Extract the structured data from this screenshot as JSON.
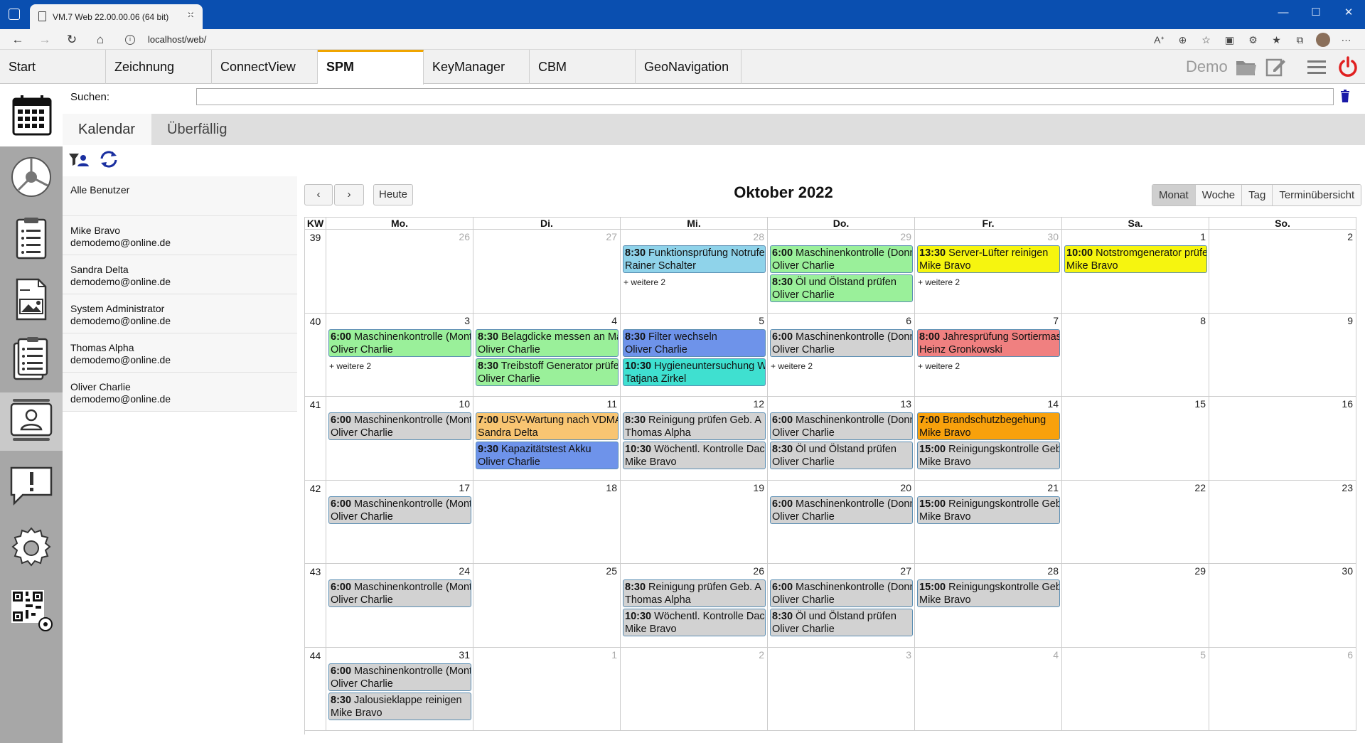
{
  "browser": {
    "tab_title": "VM.7 Web 22.00.00.06 (64 bit)",
    "url": "localhost/web/"
  },
  "app_menu": {
    "tabs": [
      "Start",
      "Zeichnung",
      "ConnectView",
      "SPM",
      "KeyManager",
      "CBM",
      "GeoNavigation"
    ],
    "active": "SPM",
    "demo_label": "Demo"
  },
  "search": {
    "label": "Suchen:",
    "value": ""
  },
  "content_tabs": [
    "Kalendar",
    "Überfällig"
  ],
  "users": {
    "all_label": "Alle Benutzer",
    "items": [
      {
        "name": "Mike Bravo",
        "email": "demodemo@online.de"
      },
      {
        "name": "Sandra Delta",
        "email": "demodemo@online.de"
      },
      {
        "name": "System Administrator",
        "email": "demodemo@online.de"
      },
      {
        "name": "Thomas Alpha",
        "email": "demodemo@online.de"
      },
      {
        "name": "Oliver Charlie",
        "email": "demodemo@online.de"
      }
    ]
  },
  "calendar": {
    "title": "Oktober 2022",
    "today_label": "Heute",
    "views": [
      "Monat",
      "Woche",
      "Tag",
      "Terminübersicht"
    ],
    "active_view": "Monat",
    "kw_header": "KW",
    "day_headers": [
      "Mo.",
      "Di.",
      "Mi.",
      "Do.",
      "Fr.",
      "Sa.",
      "So."
    ],
    "weeks": [
      {
        "kw": "39",
        "days": [
          "26",
          "27",
          "28",
          "29",
          "30",
          "1",
          "2"
        ],
        "other": [
          true,
          true,
          true,
          true,
          true,
          false,
          false
        ]
      },
      {
        "kw": "40",
        "days": [
          "3",
          "4",
          "5",
          "6",
          "7",
          "8",
          "9"
        ],
        "other": [
          false,
          false,
          false,
          false,
          false,
          false,
          false
        ]
      },
      {
        "kw": "41",
        "days": [
          "10",
          "11",
          "12",
          "13",
          "14",
          "15",
          "16"
        ],
        "other": [
          false,
          false,
          false,
          false,
          false,
          false,
          false
        ]
      },
      {
        "kw": "42",
        "days": [
          "17",
          "18",
          "19",
          "20",
          "21",
          "22",
          "23"
        ],
        "other": [
          false,
          false,
          false,
          false,
          false,
          false,
          false
        ]
      },
      {
        "kw": "43",
        "days": [
          "24",
          "25",
          "26",
          "27",
          "28",
          "29",
          "30"
        ],
        "other": [
          false,
          false,
          false,
          false,
          false,
          false,
          false
        ]
      },
      {
        "kw": "44",
        "days": [
          "31",
          "1",
          "2",
          "3",
          "4",
          "5",
          "6"
        ],
        "other": [
          false,
          true,
          true,
          true,
          true,
          true,
          true
        ]
      }
    ],
    "events": [
      {
        "week": 0,
        "day": 2,
        "slot": 0,
        "time": "8:30",
        "title": "Funktionsprüfung Notrufe",
        "person": "Rainer Schalter",
        "color": "#8fd3ea"
      },
      {
        "week": 0,
        "day": 3,
        "slot": 0,
        "time": "6:00",
        "title": "Maschinenkontrolle (Donnerstag)",
        "person": "Oliver Charlie",
        "color": "#9af09a"
      },
      {
        "week": 0,
        "day": 3,
        "slot": 1,
        "time": "8:30",
        "title": "Öl und Ölstand prüfen",
        "person": "Oliver Charlie",
        "color": "#9af09a"
      },
      {
        "week": 0,
        "day": 4,
        "slot": 0,
        "time": "13:30",
        "title": "Server-Lüfter reinigen",
        "person": "Mike Bravo",
        "color": "#f6f50f"
      },
      {
        "week": 0,
        "day": 5,
        "slot": 0,
        "time": "10:00",
        "title": "Notstromgenerator prüfen",
        "person": "Mike Bravo",
        "color": "#f6f50f"
      },
      {
        "week": 1,
        "day": 0,
        "slot": 0,
        "time": "6:00",
        "title": "Maschinenkontrolle (Montag)",
        "person": "Oliver Charlie",
        "color": "#9af09a"
      },
      {
        "week": 1,
        "day": 1,
        "slot": 0,
        "time": "8:30",
        "title": "Belagdicke messen an Maschine",
        "person": "Oliver Charlie",
        "color": "#9af09a"
      },
      {
        "week": 1,
        "day": 1,
        "slot": 1,
        "time": "8:30",
        "title": "Treibstoff Generator prüfen",
        "person": "Oliver Charlie",
        "color": "#9af09a"
      },
      {
        "week": 1,
        "day": 2,
        "slot": 0,
        "time": "8:30",
        "title": "Filter wechseln",
        "person": "Oliver Charlie",
        "color": "#6e93ea"
      },
      {
        "week": 1,
        "day": 2,
        "slot": 1,
        "time": "10:30",
        "title": "Hygieneuntersuchung Wasser",
        "person": "Tatjana Zirkel",
        "color": "#3fe0d0"
      },
      {
        "week": 1,
        "day": 3,
        "slot": 0,
        "time": "6:00",
        "title": "Maschinenkontrolle (Donnerstag)",
        "person": "Oliver Charlie",
        "color": "#d2d2d2"
      },
      {
        "week": 1,
        "day": 4,
        "slot": 0,
        "time": "8:00",
        "title": "Jahresprüfung Sortiermaschine",
        "person": "Heinz Gronkowski",
        "color": "#f08080"
      },
      {
        "week": 2,
        "day": 0,
        "slot": 0,
        "time": "6:00",
        "title": "Maschinenkontrolle (Montag)",
        "person": "Oliver Charlie",
        "color": "#d2d2d2"
      },
      {
        "week": 2,
        "day": 1,
        "slot": 0,
        "time": "7:00",
        "title": "USV-Wartung nach VDMA",
        "person": "Sandra Delta",
        "color": "#f8c572"
      },
      {
        "week": 2,
        "day": 1,
        "slot": 1,
        "time": "9:30",
        "title": "Kapazitätstest Akku",
        "person": "Oliver Charlie",
        "color": "#6e93ea"
      },
      {
        "week": 2,
        "day": 2,
        "slot": 0,
        "time": "8:30",
        "title": "Reinigung prüfen Geb. A",
        "person": "Thomas Alpha",
        "color": "#d2d2d2"
      },
      {
        "week": 2,
        "day": 2,
        "slot": 1,
        "time": "10:30",
        "title": "Wöchentl. Kontrolle Dach",
        "person": "Mike Bravo",
        "color": "#d2d2d2"
      },
      {
        "week": 2,
        "day": 3,
        "slot": 0,
        "time": "6:00",
        "title": "Maschinenkontrolle (Donnerstag)",
        "person": "Oliver Charlie",
        "color": "#d2d2d2"
      },
      {
        "week": 2,
        "day": 3,
        "slot": 1,
        "time": "8:30",
        "title": "Öl und Ölstand prüfen",
        "person": "Oliver Charlie",
        "color": "#d2d2d2"
      },
      {
        "week": 2,
        "day": 4,
        "slot": 0,
        "time": "7:00",
        "title": "Brandschutzbegehung",
        "person": "Mike Bravo",
        "color": "#f8a10c"
      },
      {
        "week": 2,
        "day": 4,
        "slot": 1,
        "time": "15:00",
        "title": "Reinigungskontrolle Geb. B",
        "person": "Mike Bravo",
        "color": "#d2d2d2"
      },
      {
        "week": 3,
        "day": 0,
        "slot": 0,
        "time": "6:00",
        "title": "Maschinenkontrolle (Montag)",
        "person": "Oliver Charlie",
        "color": "#d2d2d2"
      },
      {
        "week": 3,
        "day": 3,
        "slot": 0,
        "time": "6:00",
        "title": "Maschinenkontrolle (Donnerstag)",
        "person": "Oliver Charlie",
        "color": "#d2d2d2"
      },
      {
        "week": 3,
        "day": 4,
        "slot": 0,
        "time": "15:00",
        "title": "Reinigungskontrolle Geb. B",
        "person": "Mike Bravo",
        "color": "#d2d2d2"
      },
      {
        "week": 4,
        "day": 0,
        "slot": 0,
        "time": "6:00",
        "title": "Maschinenkontrolle (Montag)",
        "person": "Oliver Charlie",
        "color": "#d2d2d2"
      },
      {
        "week": 4,
        "day": 2,
        "slot": 0,
        "time": "8:30",
        "title": "Reinigung prüfen Geb. A",
        "person": "Thomas Alpha",
        "color": "#d2d2d2"
      },
      {
        "week": 4,
        "day": 2,
        "slot": 1,
        "time": "10:30",
        "title": "Wöchentl. Kontrolle Dach",
        "person": "Mike Bravo",
        "color": "#d2d2d2"
      },
      {
        "week": 4,
        "day": 3,
        "slot": 0,
        "time": "6:00",
        "title": "Maschinenkontrolle (Donnerstag)",
        "person": "Oliver Charlie",
        "color": "#d2d2d2"
      },
      {
        "week": 4,
        "day": 3,
        "slot": 1,
        "time": "8:30",
        "title": "Öl und Ölstand prüfen",
        "person": "Oliver Charlie",
        "color": "#d2d2d2"
      },
      {
        "week": 4,
        "day": 4,
        "slot": 0,
        "time": "15:00",
        "title": "Reinigungskontrolle Geb. B",
        "person": "Mike Bravo",
        "color": "#d2d2d2"
      },
      {
        "week": 5,
        "day": 0,
        "slot": 0,
        "time": "6:00",
        "title": "Maschinenkontrolle (Montag)",
        "person": "Oliver Charlie",
        "color": "#d2d2d2"
      },
      {
        "week": 5,
        "day": 0,
        "slot": 1,
        "time": "8:30",
        "title": "Jalousieklappe reinigen",
        "person": "Mike Bravo",
        "color": "#d2d2d2"
      }
    ],
    "more": [
      {
        "week": 0,
        "day": 2,
        "slot": 1,
        "label": "+ weitere 2"
      },
      {
        "week": 0,
        "day": 4,
        "slot": 1,
        "label": "+ weitere 2"
      },
      {
        "week": 1,
        "day": 0,
        "slot": 1,
        "label": "+ weitere 2"
      },
      {
        "week": 1,
        "day": 3,
        "slot": 1,
        "label": "+ weitere 2"
      },
      {
        "week": 1,
        "day": 4,
        "slot": 1,
        "label": "+ weitere 2"
      }
    ]
  }
}
